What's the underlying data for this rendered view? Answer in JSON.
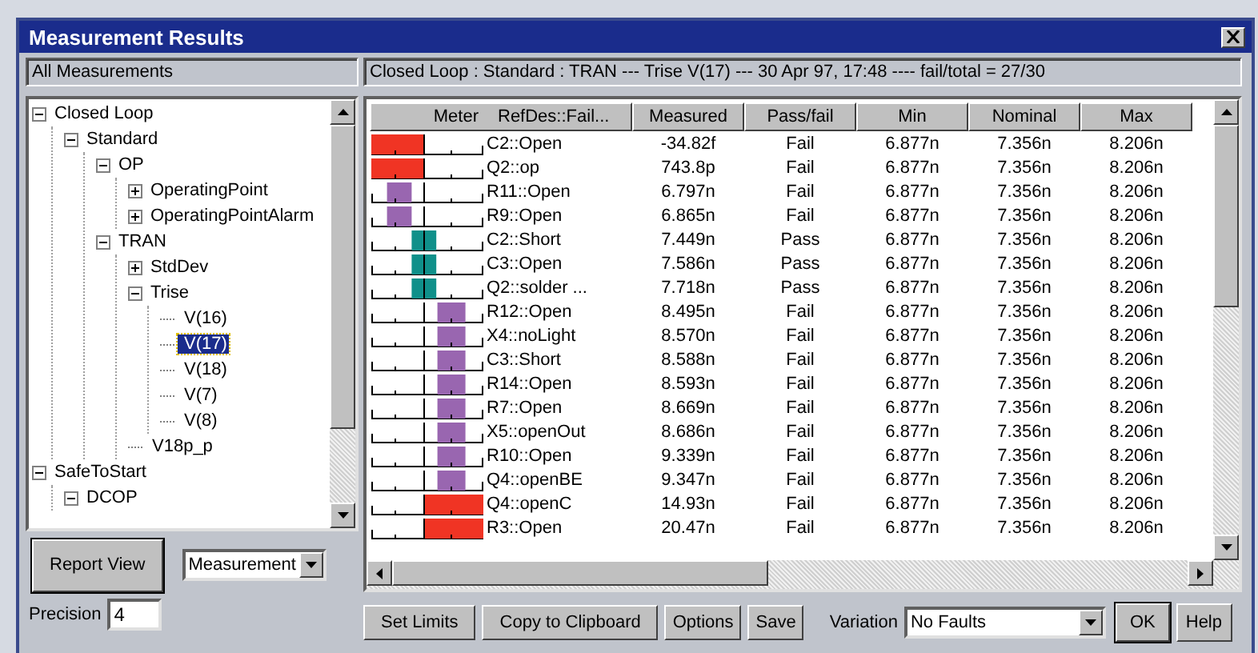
{
  "window": {
    "title": "Measurement Results"
  },
  "left_header": "All Measurements",
  "summary": "Closed Loop : Standard : TRAN --- Trise  V(17)   --- 30 Apr 97, 17:48 ---- fail/total = 27/30",
  "tree": [
    {
      "label": "Closed Loop",
      "expanded": true,
      "selected": false,
      "children": [
        {
          "label": "Standard",
          "expanded": true,
          "selected": false,
          "children": [
            {
              "label": "OP",
              "expanded": true,
              "selected": false,
              "children": [
                {
                  "label": "OperatingPoint",
                  "expanded": false,
                  "selected": false
                },
                {
                  "label": "OperatingPointAlarm",
                  "expanded": false,
                  "selected": false
                }
              ]
            },
            {
              "label": "TRAN",
              "expanded": true,
              "selected": false,
              "children": [
                {
                  "label": "StdDev",
                  "expanded": false,
                  "selected": false
                },
                {
                  "label": "Trise",
                  "expanded": true,
                  "selected": false,
                  "children": [
                    {
                      "label": "V(16)",
                      "selected": false
                    },
                    {
                      "label": "V(17)",
                      "selected": true
                    },
                    {
                      "label": "V(18)",
                      "selected": false
                    },
                    {
                      "label": "V(7)",
                      "selected": false
                    },
                    {
                      "label": "V(8)",
                      "selected": false
                    }
                  ]
                },
                {
                  "label": "V18p_p",
                  "selected": false
                }
              ]
            }
          ]
        }
      ]
    },
    {
      "label": "SafeToStart",
      "expanded": true,
      "selected": false,
      "children": [
        {
          "label": "DCOP",
          "expanded": true,
          "selected": false
        }
      ]
    }
  ],
  "report_view_button": "Report View",
  "view_select": {
    "value": "Measurement"
  },
  "precision": {
    "label": "Precision",
    "value": "4"
  },
  "table": {
    "columns": [
      "Meter",
      "RefDes::Fail...",
      "Measured",
      "Pass/fail",
      "Min",
      "Nominal",
      "Max"
    ],
    "rows": [
      {
        "kind": "below",
        "refdes": "C2::Open",
        "measured": "-34.82f",
        "result": "Fail",
        "min": "6.877n",
        "nominal": "7.356n",
        "max": "8.206n"
      },
      {
        "kind": "below",
        "refdes": "Q2::op",
        "measured": "743.8p",
        "result": "Fail",
        "min": "6.877n",
        "nominal": "7.356n",
        "max": "8.206n"
      },
      {
        "kind": "low",
        "refdes": "R11::Open",
        "measured": "6.797n",
        "result": "Fail",
        "min": "6.877n",
        "nominal": "7.356n",
        "max": "8.206n"
      },
      {
        "kind": "low",
        "refdes": "R9::Open",
        "measured": "6.865n",
        "result": "Fail",
        "min": "6.877n",
        "nominal": "7.356n",
        "max": "8.206n"
      },
      {
        "kind": "pass",
        "refdes": "C2::Short",
        "measured": "7.449n",
        "result": "Pass",
        "min": "6.877n",
        "nominal": "7.356n",
        "max": "8.206n"
      },
      {
        "kind": "pass",
        "refdes": "C3::Open",
        "measured": "7.586n",
        "result": "Pass",
        "min": "6.877n",
        "nominal": "7.356n",
        "max": "8.206n"
      },
      {
        "kind": "pass",
        "refdes": "Q2::solder ...",
        "measured": "7.718n",
        "result": "Pass",
        "min": "6.877n",
        "nominal": "7.356n",
        "max": "8.206n"
      },
      {
        "kind": "high",
        "refdes": "R12::Open",
        "measured": "8.495n",
        "result": "Fail",
        "min": "6.877n",
        "nominal": "7.356n",
        "max": "8.206n"
      },
      {
        "kind": "high",
        "refdes": "X4::noLight",
        "measured": "8.570n",
        "result": "Fail",
        "min": "6.877n",
        "nominal": "7.356n",
        "max": "8.206n"
      },
      {
        "kind": "high",
        "refdes": "C3::Short",
        "measured": "8.588n",
        "result": "Fail",
        "min": "6.877n",
        "nominal": "7.356n",
        "max": "8.206n"
      },
      {
        "kind": "high",
        "refdes": "R14::Open",
        "measured": "8.593n",
        "result": "Fail",
        "min": "6.877n",
        "nominal": "7.356n",
        "max": "8.206n"
      },
      {
        "kind": "high",
        "refdes": "R7::Open",
        "measured": "8.669n",
        "result": "Fail",
        "min": "6.877n",
        "nominal": "7.356n",
        "max": "8.206n"
      },
      {
        "kind": "high",
        "refdes": "X5::openOut",
        "measured": "8.686n",
        "result": "Fail",
        "min": "6.877n",
        "nominal": "7.356n",
        "max": "8.206n"
      },
      {
        "kind": "high",
        "refdes": "R10::Open",
        "measured": "9.339n",
        "result": "Fail",
        "min": "6.877n",
        "nominal": "7.356n",
        "max": "8.206n"
      },
      {
        "kind": "high",
        "refdes": "Q4::openBE",
        "measured": "9.347n",
        "result": "Fail",
        "min": "6.877n",
        "nominal": "7.356n",
        "max": "8.206n"
      },
      {
        "kind": "above",
        "refdes": "Q4::openC",
        "measured": "14.93n",
        "result": "Fail",
        "min": "6.877n",
        "nominal": "7.356n",
        "max": "8.206n"
      },
      {
        "kind": "above",
        "refdes": "R3::Open",
        "measured": "20.47n",
        "result": "Fail",
        "min": "6.877n",
        "nominal": "7.356n",
        "max": "8.206n"
      }
    ]
  },
  "action_buttons": [
    "Set Limits",
    "Copy to Clipboard",
    "Options",
    "Save"
  ],
  "variation": {
    "label": "Variation",
    "value": "No Faults"
  },
  "dialog_buttons": [
    "OK",
    "Help"
  ]
}
